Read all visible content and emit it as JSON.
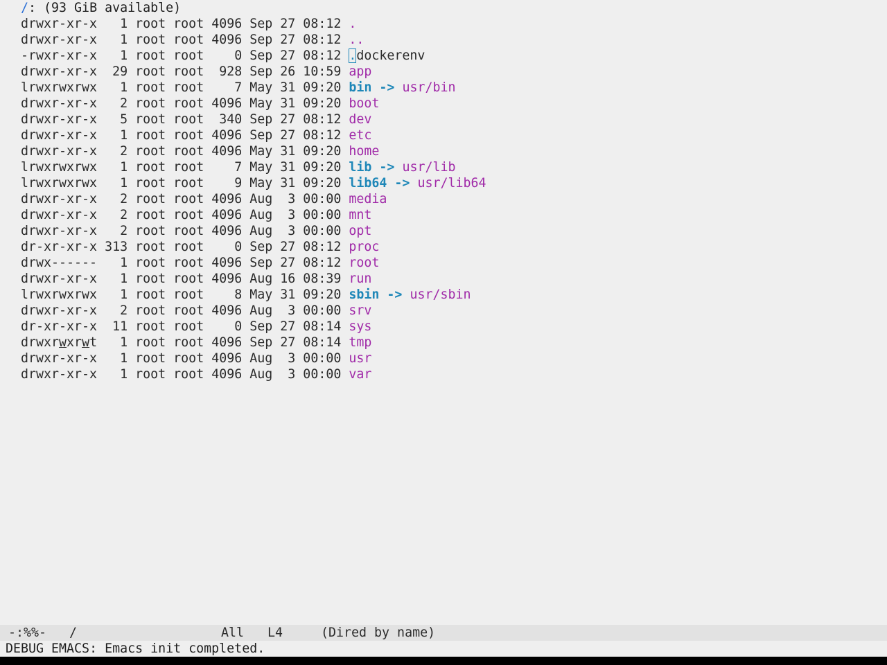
{
  "header": {
    "dir": "/",
    "rest": ": (93 GiB available)"
  },
  "entries": [
    {
      "perm": "drwxr-xr-x",
      "links": "1",
      "owner": "root",
      "group": "root",
      "size": "4096",
      "month": "Sep",
      "day": "27",
      "time": "08:12",
      "name": "."
    },
    {
      "perm": "drwxr-xr-x",
      "links": "1",
      "owner": "root",
      "group": "root",
      "size": "4096",
      "month": "Sep",
      "day": "27",
      "time": "08:12",
      "name": ".."
    },
    {
      "perm": "-rwxr-xr-x",
      "links": "1",
      "owner": "root",
      "group": "root",
      "size": "0",
      "month": "Sep",
      "day": "27",
      "time": "08:12",
      "name": ".dockerenv"
    },
    {
      "perm": "drwxr-xr-x",
      "links": "29",
      "owner": "root",
      "group": "root",
      "size": "928",
      "month": "Sep",
      "day": "26",
      "time": "10:59",
      "name": "app"
    },
    {
      "perm": "lrwxrwxrwx",
      "links": "1",
      "owner": "root",
      "group": "root",
      "size": "7",
      "month": "May",
      "day": "31",
      "time": "09:20",
      "name": "bin",
      "target": "usr/bin"
    },
    {
      "perm": "drwxr-xr-x",
      "links": "2",
      "owner": "root",
      "group": "root",
      "size": "4096",
      "month": "May",
      "day": "31",
      "time": "09:20",
      "name": "boot"
    },
    {
      "perm": "drwxr-xr-x",
      "links": "5",
      "owner": "root",
      "group": "root",
      "size": "340",
      "month": "Sep",
      "day": "27",
      "time": "08:12",
      "name": "dev"
    },
    {
      "perm": "drwxr-xr-x",
      "links": "1",
      "owner": "root",
      "group": "root",
      "size": "4096",
      "month": "Sep",
      "day": "27",
      "time": "08:12",
      "name": "etc"
    },
    {
      "perm": "drwxr-xr-x",
      "links": "2",
      "owner": "root",
      "group": "root",
      "size": "4096",
      "month": "May",
      "day": "31",
      "time": "09:20",
      "name": "home"
    },
    {
      "perm": "lrwxrwxrwx",
      "links": "1",
      "owner": "root",
      "group": "root",
      "size": "7",
      "month": "May",
      "day": "31",
      "time": "09:20",
      "name": "lib",
      "target": "usr/lib"
    },
    {
      "perm": "lrwxrwxrwx",
      "links": "1",
      "owner": "root",
      "group": "root",
      "size": "9",
      "month": "May",
      "day": "31",
      "time": "09:20",
      "name": "lib64",
      "target": "usr/lib64"
    },
    {
      "perm": "drwxr-xr-x",
      "links": "2",
      "owner": "root",
      "group": "root",
      "size": "4096",
      "month": "Aug",
      "day": "3",
      "time": "00:00",
      "name": "media"
    },
    {
      "perm": "drwxr-xr-x",
      "links": "2",
      "owner": "root",
      "group": "root",
      "size": "4096",
      "month": "Aug",
      "day": "3",
      "time": "00:00",
      "name": "mnt"
    },
    {
      "perm": "drwxr-xr-x",
      "links": "2",
      "owner": "root",
      "group": "root",
      "size": "4096",
      "month": "Aug",
      "day": "3",
      "time": "00:00",
      "name": "opt"
    },
    {
      "perm": "dr-xr-xr-x",
      "links": "313",
      "owner": "root",
      "group": "root",
      "size": "0",
      "month": "Sep",
      "day": "27",
      "time": "08:12",
      "name": "proc"
    },
    {
      "perm": "drwx------",
      "links": "1",
      "owner": "root",
      "group": "root",
      "size": "4096",
      "month": "Sep",
      "day": "27",
      "time": "08:12",
      "name": "root"
    },
    {
      "perm": "drwxr-xr-x",
      "links": "1",
      "owner": "root",
      "group": "root",
      "size": "4096",
      "month": "Aug",
      "day": "16",
      "time": "08:39",
      "name": "run"
    },
    {
      "perm": "lrwxrwxrwx",
      "links": "1",
      "owner": "root",
      "group": "root",
      "size": "8",
      "month": "May",
      "day": "31",
      "time": "09:20",
      "name": "sbin",
      "target": "usr/sbin"
    },
    {
      "perm": "drwxr-xr-x",
      "links": "2",
      "owner": "root",
      "group": "root",
      "size": "4096",
      "month": "Aug",
      "day": "3",
      "time": "00:00",
      "name": "srv"
    },
    {
      "perm": "dr-xr-xr-x",
      "links": "11",
      "owner": "root",
      "group": "root",
      "size": "0",
      "month": "Sep",
      "day": "27",
      "time": "08:14",
      "name": "sys"
    },
    {
      "perm": "drwxrwxrwt",
      "links": "1",
      "owner": "root",
      "group": "root",
      "size": "4096",
      "month": "Sep",
      "day": "27",
      "time": "08:14",
      "name": "tmp"
    },
    {
      "perm": "drwxr-xr-x",
      "links": "1",
      "owner": "root",
      "group": "root",
      "size": "4096",
      "month": "Aug",
      "day": "3",
      "time": "00:00",
      "name": "usr"
    },
    {
      "perm": "drwxr-xr-x",
      "links": "1",
      "owner": "root",
      "group": "root",
      "size": "4096",
      "month": "Aug",
      "day": "3",
      "time": "00:00",
      "name": "var"
    }
  ],
  "arrow_text": "->",
  "modeline": {
    "status": "-:%%-",
    "buffer": "/",
    "position": "All",
    "line": "L4",
    "mode": "(Dired by name)"
  },
  "echo_area": "DEBUG EMACS: Emacs init completed.",
  "colors": {
    "directory": "#a02aa8",
    "symlink": "#1e87b8",
    "header_dir": "#2a6fd6",
    "background": "#efefef",
    "modeline_bg": "#e2e2e2"
  }
}
